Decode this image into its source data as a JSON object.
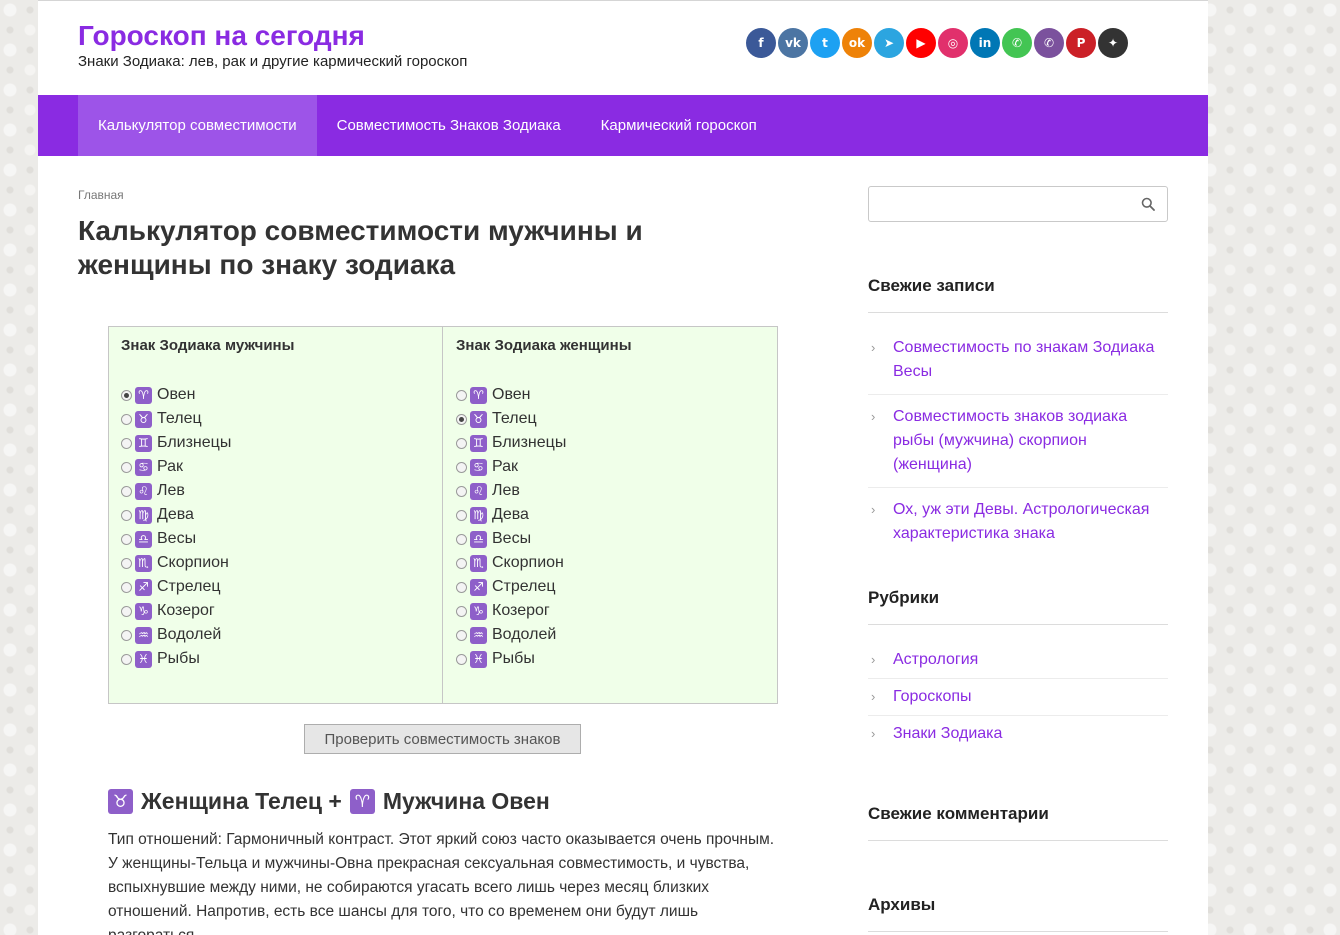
{
  "site": {
    "title": "Гороскоп на сегодня",
    "description": "Знаки Зодиака: лев, рак и другие кармический гороскоп"
  },
  "social": [
    {
      "icon": "facebook-icon",
      "glyph": "f",
      "color": "#3b5998"
    },
    {
      "icon": "vk-icon",
      "glyph": "vk",
      "color": "#4c75a3"
    },
    {
      "icon": "twitter-icon",
      "glyph": "t",
      "color": "#1da1f2"
    },
    {
      "icon": "odnoklassniki-icon",
      "glyph": "ok",
      "color": "#ee8208"
    },
    {
      "icon": "telegram-icon",
      "glyph": "➤",
      "color": "#2ca5e0"
    },
    {
      "icon": "youtube-icon",
      "glyph": "▶",
      "color": "#ff0000"
    },
    {
      "icon": "instagram-icon",
      "glyph": "◎",
      "color": "#e1306c"
    },
    {
      "icon": "linkedin-icon",
      "glyph": "in",
      "color": "#0077b5"
    },
    {
      "icon": "whatsapp-icon",
      "glyph": "✆",
      "color": "#43c553"
    },
    {
      "icon": "viber-icon",
      "glyph": "✆",
      "color": "#7b519d"
    },
    {
      "icon": "pinterest-icon",
      "glyph": "P",
      "color": "#cb2027"
    },
    {
      "icon": "yandex-zen-icon",
      "glyph": "✦",
      "color": "#333333"
    }
  ],
  "nav": [
    {
      "label": "Калькулятор совместимости",
      "active": true
    },
    {
      "label": "Совместимость Знаков Зодиака",
      "active": false
    },
    {
      "label": "Кармический гороскоп",
      "active": false
    }
  ],
  "breadcrumb": "Главная",
  "page_title": "Калькулятор совместимости мужчины и женщины по знаку зодиака",
  "calculator": {
    "male_title": "Знак Зодиака мужчины",
    "female_title": "Знак Зодиака женщины",
    "signs": [
      {
        "symbol": "♈",
        "name": "Овен",
        "icon": "aries-icon"
      },
      {
        "symbol": "♉",
        "name": "Телец",
        "icon": "taurus-icon"
      },
      {
        "symbol": "♊",
        "name": "Близнецы",
        "icon": "gemini-icon"
      },
      {
        "symbol": "♋",
        "name": "Рак",
        "icon": "cancer-icon"
      },
      {
        "symbol": "♌",
        "name": "Лев",
        "icon": "leo-icon"
      },
      {
        "symbol": "♍",
        "name": "Дева",
        "icon": "virgo-icon"
      },
      {
        "symbol": "♎",
        "name": "Весы",
        "icon": "libra-icon"
      },
      {
        "symbol": "♏",
        "name": "Скорпион",
        "icon": "scorpio-icon"
      },
      {
        "symbol": "♐",
        "name": "Стрелец",
        "icon": "sagittarius-icon"
      },
      {
        "symbol": "♑",
        "name": "Козерог",
        "icon": "capricorn-icon"
      },
      {
        "symbol": "♒",
        "name": "Водолей",
        "icon": "aquarius-icon"
      },
      {
        "symbol": "♓",
        "name": "Рыбы",
        "icon": "pisces-icon"
      }
    ],
    "male_selected": 0,
    "female_selected": 1,
    "button_label": "Проверить совместимость знаков"
  },
  "result": {
    "woman_symbol": "♉",
    "woman_text": "Женщина Телец +",
    "man_symbol": "♈",
    "man_text": "Мужчина Овен",
    "paragraph": "Тип отношений: Гармоничный контраст. Этот яркий союз часто оказывается очень прочным. У женщины-Тельца и мужчины-Овна прекрасная сексуальная совместимость, и чувства, вспыхнувшие между ними, не собираются угасать всего лишь через месяц близких отношений. Напротив, есть все шансы для того, что со временем они будут лишь разгораться."
  },
  "sidebar": {
    "search_placeholder": "",
    "recent_posts_title": "Свежие записи",
    "recent_posts": [
      "Совместимость по знакам Зодиака Весы",
      "Совместимость знаков зодиака рыбы (мужчина) скорпион (женщина)",
      "Ох, уж эти Девы. Астрологическая характеристика знака"
    ],
    "categories_title": "Рубрики",
    "categories": [
      "Астрология",
      "Гороскопы",
      "Знаки Зодиака"
    ],
    "recent_comments_title": "Свежие комментарии",
    "archives_title": "Архивы"
  },
  "colors": {
    "brand": "#8a2be2",
    "nav_active": "#9d54e8",
    "calc_bg": "#f0ffe9",
    "zodiac_badge": "#8e5fc9"
  }
}
